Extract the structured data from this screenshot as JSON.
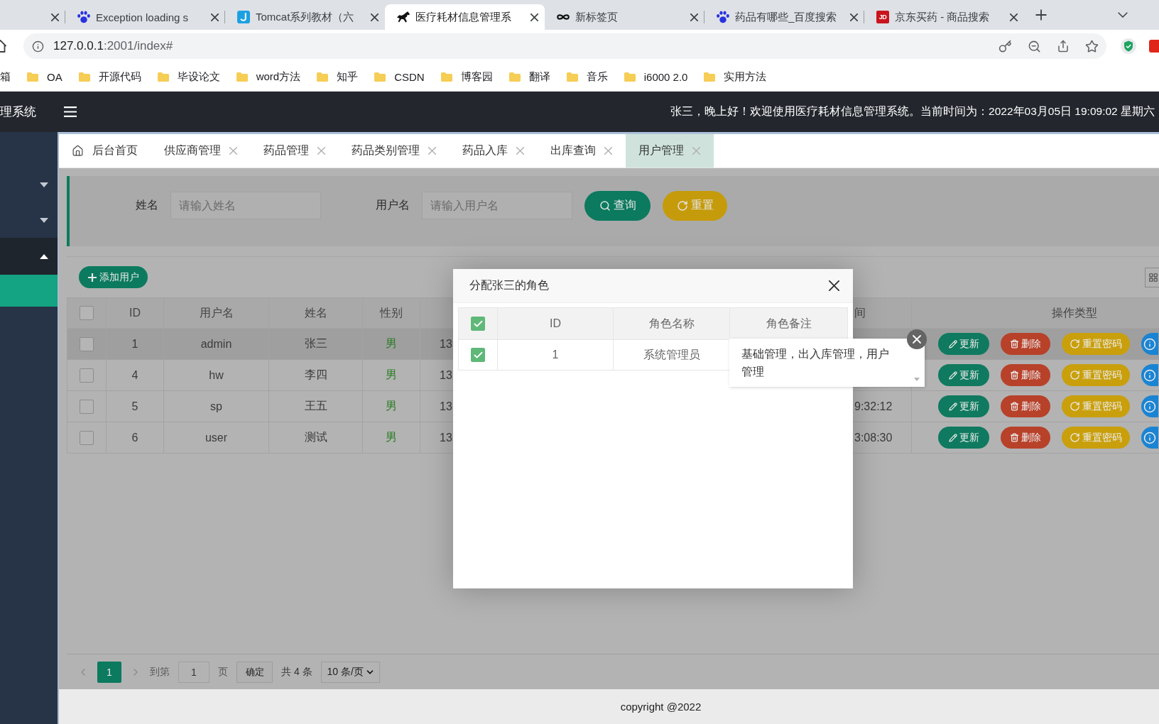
{
  "browser_tabs": [
    {
      "selected": false
    },
    {
      "title": "Exception loading s",
      "kind": "paw",
      "selected": false
    },
    {
      "title": "Tomcat系列教材（六",
      "kind": "hook-tile",
      "selected": false
    },
    {
      "title": "医疗耗材信息管理系",
      "kind": "horse",
      "selected": true
    },
    {
      "title": "新标签页",
      "kind": "loop",
      "selected": false
    },
    {
      "title": "药品有哪些_百度搜索",
      "kind": "paw",
      "selected": false
    },
    {
      "title": "京东买药 - 商品搜索",
      "kind": "letter-tile",
      "logo_text": "JD",
      "selected": false
    }
  ],
  "address_bar": {
    "host": "127.0.0.1",
    "path": ":2001/index#"
  },
  "bookmarks": [
    {
      "label": "箱",
      "kind": "text"
    },
    {
      "label": "OA",
      "kind": "folder"
    },
    {
      "label": "开源代码",
      "kind": "folder"
    },
    {
      "label": "毕设论文",
      "kind": "folder"
    },
    {
      "label": "word方法",
      "kind": "folder"
    },
    {
      "label": "知乎",
      "kind": "folder"
    },
    {
      "label": "CSDN",
      "kind": "folder"
    },
    {
      "label": "博客园",
      "kind": "folder"
    },
    {
      "label": "翻译",
      "kind": "folder"
    },
    {
      "label": "音乐",
      "kind": "folder"
    },
    {
      "label": "i6000 2.0",
      "kind": "folder"
    },
    {
      "label": "实用方法",
      "kind": "folder"
    }
  ],
  "header": {
    "title": "理系统",
    "greeting": "张三，晚上好！欢迎使用医疗耗材信息管理系统。当前时间为：2022年03月05日 19:09:02 星期六"
  },
  "sidebar": {
    "items": [
      {
        "expanded": false
      },
      {
        "expanded": false
      },
      {
        "expanded": true,
        "children": [
          {
            "selected": true
          }
        ]
      }
    ]
  },
  "tabs": [
    {
      "label": "后台首页",
      "kind": "home",
      "closable": false,
      "selected": false
    },
    {
      "label": "供应商管理",
      "kind": "page",
      "closable": true,
      "selected": false
    },
    {
      "label": "药品管理",
      "kind": "page",
      "closable": true,
      "selected": false
    },
    {
      "label": "药品类别管理",
      "kind": "page",
      "closable": true,
      "selected": false
    },
    {
      "label": "药品入库",
      "kind": "page",
      "closable": true,
      "selected": false
    },
    {
      "label": "出库查询",
      "kind": "page",
      "closable": true,
      "selected": false
    },
    {
      "label": "用户管理",
      "kind": "page",
      "closable": true,
      "selected": true
    }
  ],
  "search": {
    "fields": [
      {
        "label": "姓名",
        "placeholder": "请输入姓名"
      },
      {
        "label": "用户名",
        "placeholder": "请输入用户名"
      }
    ],
    "buttons": [
      {
        "label": "查询",
        "kind": "search"
      },
      {
        "label": "重置",
        "kind": "reset"
      }
    ]
  },
  "table": {
    "add_button": "添加用户",
    "all_checked": false,
    "columns": [
      "ID",
      "用户名",
      "姓名",
      "性别",
      "间",
      "操作类型"
    ],
    "rows": [
      {
        "checked": false,
        "hovered": true,
        "id": "1",
        "username": "admin",
        "name": "张三",
        "gender": "男",
        "column_5": "13",
        "actions": [
          {
            "label": "更新",
            "kind": "edit"
          },
          {
            "label": "删除",
            "kind": "delete"
          },
          {
            "label": "重置密码",
            "kind": "reset"
          },
          {
            "kind": "info"
          }
        ]
      },
      {
        "checked": false,
        "hovered": false,
        "id": "4",
        "username": "hw",
        "name": "李四",
        "gender": "男",
        "column_5": "13",
        "actions": [
          {
            "label": "更新",
            "kind": "edit"
          },
          {
            "label": "删除",
            "kind": "delete"
          },
          {
            "label": "重置密码",
            "kind": "reset"
          },
          {
            "kind": "info"
          }
        ]
      },
      {
        "checked": false,
        "hovered": false,
        "id": "5",
        "username": "sp",
        "name": "王五",
        "gender": "男",
        "column_5": "13",
        "column_6": "9:32:12",
        "actions": [
          {
            "label": "更新",
            "kind": "edit"
          },
          {
            "label": "删除",
            "kind": "delete"
          },
          {
            "label": "重置密码",
            "kind": "reset"
          },
          {
            "kind": "info"
          }
        ]
      },
      {
        "checked": false,
        "hovered": false,
        "id": "6",
        "username": "user",
        "name": "测试",
        "gender": "男",
        "column_5": "13",
        "column_6": "3:08:30",
        "actions": [
          {
            "label": "更新",
            "kind": "edit"
          },
          {
            "label": "删除",
            "kind": "delete"
          },
          {
            "label": "重置密码",
            "kind": "reset"
          },
          {
            "kind": "info"
          }
        ]
      }
    ]
  },
  "pagination": {
    "pages": [
      {
        "label": "1",
        "selected": true
      }
    ],
    "goto_label": "到第",
    "goto_value": "1",
    "page_unit": "页",
    "confirm": "确定",
    "total": "共 4 条",
    "page_size": "10 条/页"
  },
  "footer": "copyright @2022",
  "modal": {
    "title": "分配张三的角色",
    "all_checked": true,
    "columns": [
      "ID",
      "角色名称",
      "角色备注"
    ],
    "rows": [
      {
        "checked": true,
        "id": "1",
        "role_name": "系统管理员"
      }
    ],
    "tip": "基础管理，出入库管理，用户管理"
  }
}
